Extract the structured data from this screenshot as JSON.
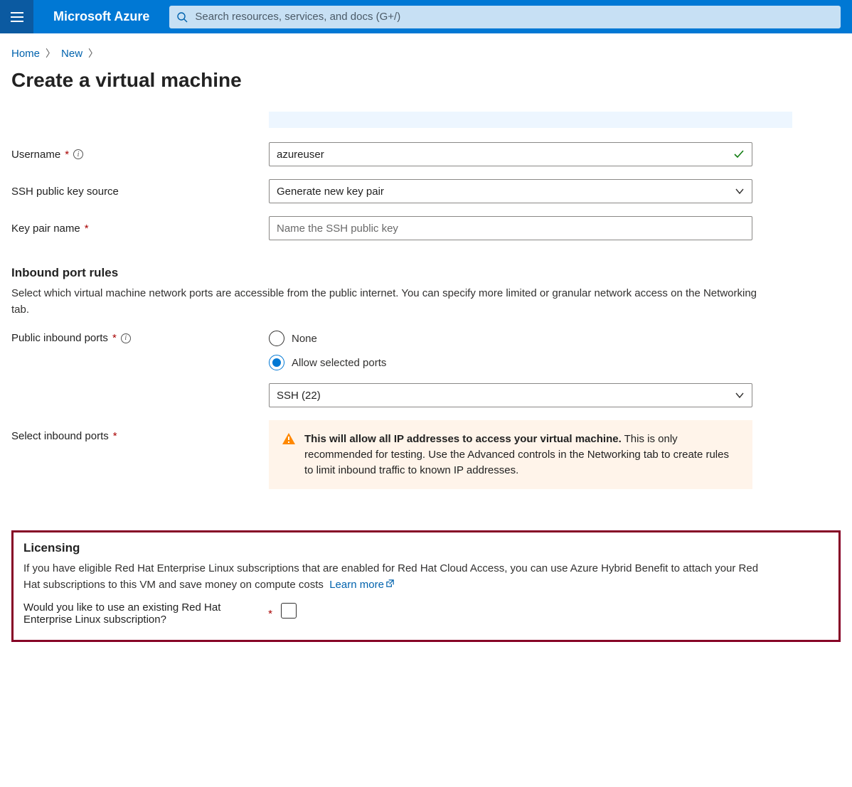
{
  "header": {
    "brand": "Microsoft Azure",
    "search_placeholder": "Search resources, services, and docs (G+/)"
  },
  "breadcrumb": {
    "home": "Home",
    "new": "New"
  },
  "page_title": "Create a virtual machine",
  "form": {
    "username_label": "Username",
    "username_value": "azureuser",
    "ssh_source_label": "SSH public key source",
    "ssh_source_value": "Generate new key pair",
    "keypair_label": "Key pair name",
    "keypair_placeholder": "Name the SSH public key"
  },
  "inbound": {
    "heading": "Inbound port rules",
    "desc": "Select which virtual machine network ports are accessible from the public internet. You can specify more limited or granular network access on the Networking tab.",
    "public_label": "Public inbound ports",
    "radio_none": "None",
    "radio_allow": "Allow selected ports",
    "select_label": "Select inbound ports",
    "select_value": "SSH (22)",
    "warn_strong": "This will allow all IP addresses to access your virtual machine.",
    "warn_rest": " This is only recommended for testing.  Use the Advanced controls in the Networking tab to create rules to limit inbound traffic to known IP addresses."
  },
  "licensing": {
    "heading": "Licensing",
    "desc": "If you have eligible Red Hat Enterprise Linux subscriptions that are enabled for Red Hat Cloud Access, you can use Azure Hybrid Benefit to attach your Red Hat subscriptions to this VM and save money on compute costs",
    "learn_more": "Learn more",
    "question": "Would you like to use an existing Red Hat Enterprise Linux subscription?"
  }
}
